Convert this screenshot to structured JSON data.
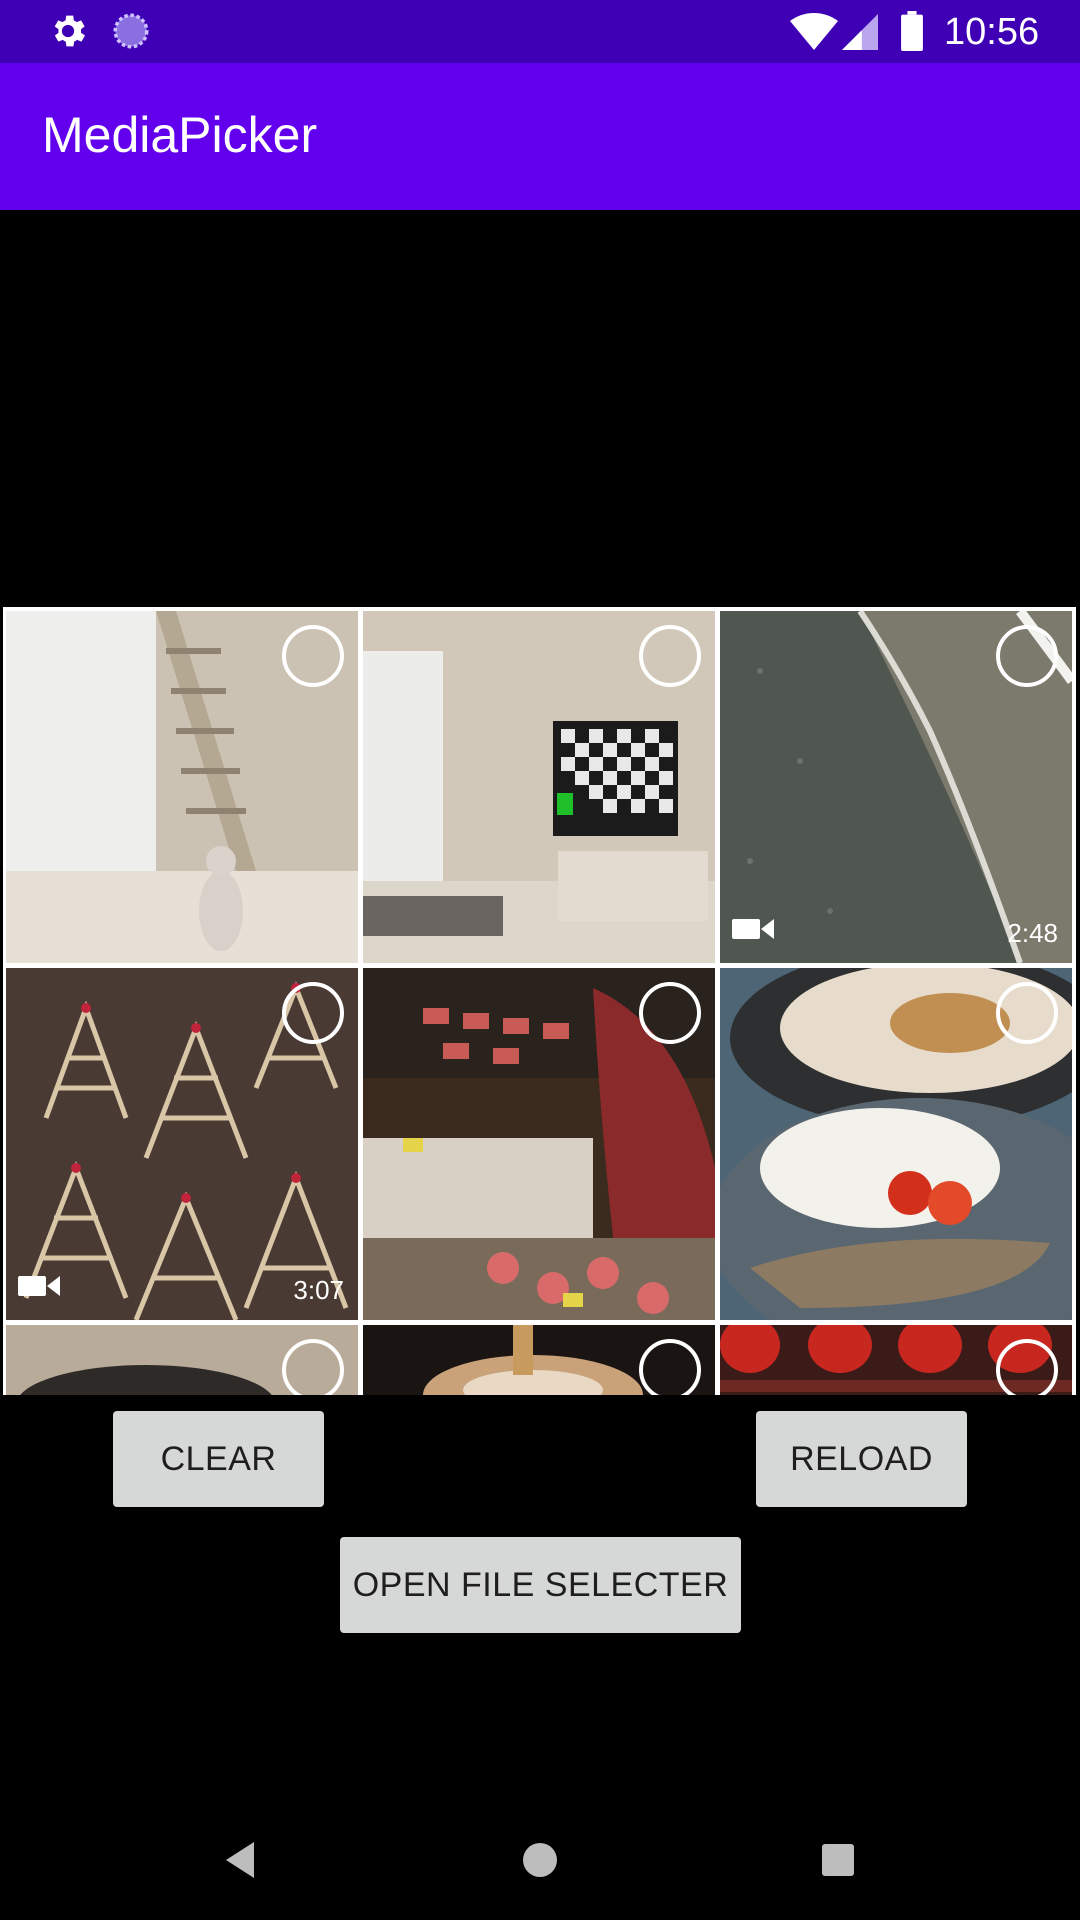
{
  "status_bar": {
    "time": "10:56",
    "icons": [
      "gear-icon",
      "sync-icon",
      "wifi-icon",
      "cell-signal-icon",
      "battery-icon"
    ],
    "color": "#3f00b5"
  },
  "app_bar": {
    "title": "MediaPicker",
    "color": "#6200ee"
  },
  "grid": {
    "items": [
      {
        "type": "image",
        "selected": false,
        "subject": "white room with bookshelf and cat"
      },
      {
        "type": "image",
        "selected": false,
        "subject": "white room with checkerboard TV"
      },
      {
        "type": "video",
        "selected": false,
        "duration": "2:48",
        "subject": "aerial ocean shoreline"
      },
      {
        "type": "video",
        "selected": false,
        "duration": "3:07",
        "subject": "hanging incense coils"
      },
      {
        "type": "image",
        "selected": false,
        "subject": "market food stall"
      },
      {
        "type": "image",
        "selected": false,
        "subject": "grilled fish plate"
      },
      {
        "type": "image",
        "selected": false,
        "subject": "bowl close-up"
      },
      {
        "type": "image",
        "selected": false,
        "subject": "noodle soup"
      },
      {
        "type": "image",
        "selected": false,
        "subject": "red lanterns"
      }
    ]
  },
  "buttons": {
    "clear": "CLEAR",
    "reload": "RELOAD",
    "open_file_selecter": "OPEN FILE SELECTER"
  },
  "nav_bar": {
    "icons": [
      "back-icon",
      "home-icon",
      "recents-icon"
    ]
  }
}
